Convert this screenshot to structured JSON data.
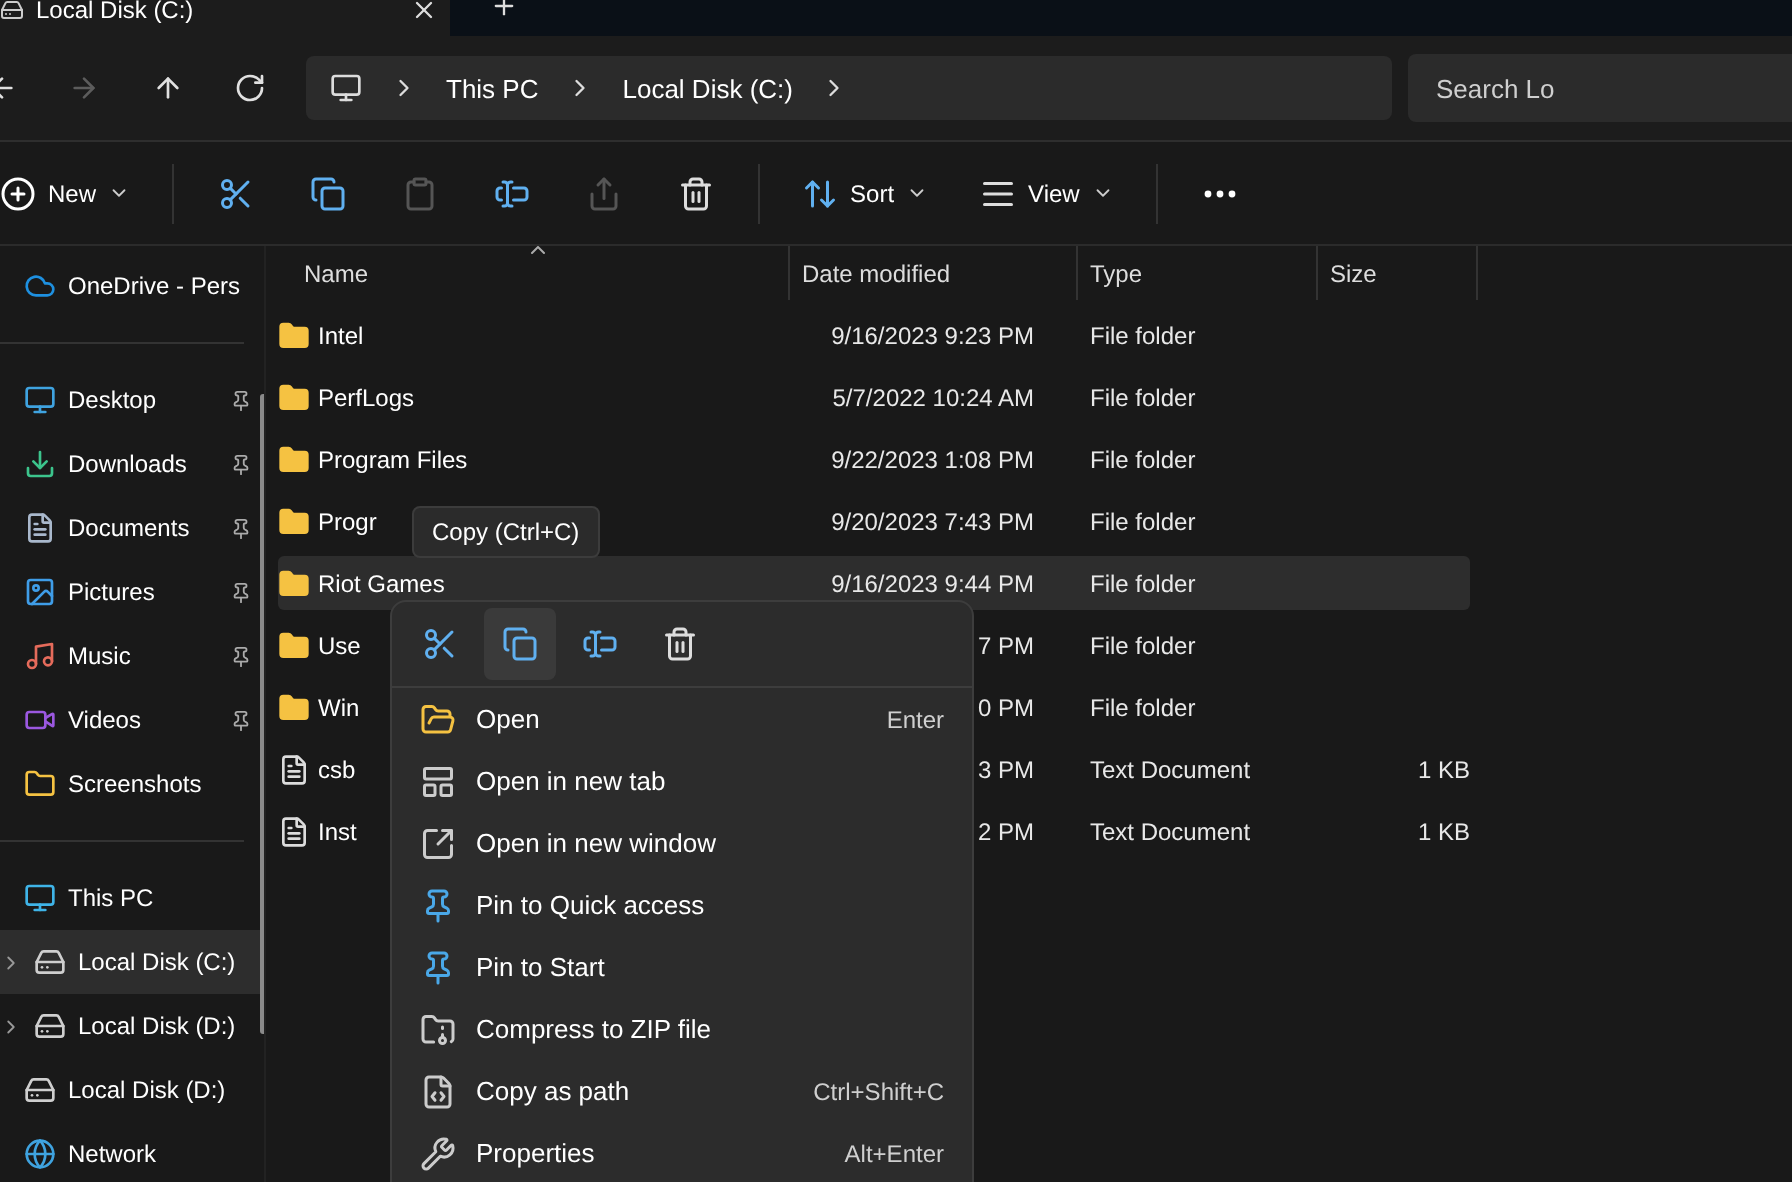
{
  "tabs": [
    {
      "label": "Local Disk (C:)",
      "selected": true
    }
  ],
  "address": {
    "crumbs": [
      "This PC",
      "Local Disk (C:)"
    ],
    "search_placeholder": "Search Lo"
  },
  "nav_buttons": [
    {
      "kind": "back",
      "disabled": false
    },
    {
      "kind": "forward",
      "disabled": true
    },
    {
      "kind": "up",
      "disabled": false
    },
    {
      "kind": "refresh",
      "disabled": false
    }
  ],
  "toolbar": [
    {
      "kind": "new",
      "label": "New",
      "disabled": false
    },
    {
      "kind": "cut",
      "disabled": false
    },
    {
      "kind": "copy",
      "disabled": false
    },
    {
      "kind": "paste",
      "disabled": true
    },
    {
      "kind": "rename",
      "disabled": false
    },
    {
      "kind": "share",
      "disabled": true
    },
    {
      "kind": "delete",
      "disabled": false
    },
    {
      "kind": "sort",
      "label": "Sort",
      "disabled": false
    },
    {
      "kind": "view",
      "label": "View",
      "disabled": false
    },
    {
      "kind": "more",
      "disabled": false
    }
  ],
  "sidebar": [
    {
      "kind": "onedrive",
      "label": "OneDrive - Pers",
      "pinned": false,
      "selected": false,
      "expander": false,
      "group_end": true
    },
    {
      "kind": "desktop",
      "label": "Desktop",
      "pinned": true,
      "selected": false,
      "expander": false,
      "group_end": false
    },
    {
      "kind": "downloads",
      "label": "Downloads",
      "pinned": true,
      "selected": false,
      "expander": false,
      "group_end": false
    },
    {
      "kind": "documents",
      "label": "Documents",
      "pinned": true,
      "selected": false,
      "expander": false,
      "group_end": false
    },
    {
      "kind": "pictures",
      "label": "Pictures",
      "pinned": true,
      "selected": false,
      "expander": false,
      "group_end": false
    },
    {
      "kind": "music",
      "label": "Music",
      "pinned": true,
      "selected": false,
      "expander": false,
      "group_end": false
    },
    {
      "kind": "videos",
      "label": "Videos",
      "pinned": true,
      "selected": false,
      "expander": false,
      "group_end": false
    },
    {
      "kind": "folder",
      "label": "Screenshots",
      "pinned": false,
      "selected": false,
      "expander": false,
      "group_end": true
    },
    {
      "kind": "pc",
      "label": "This PC",
      "pinned": false,
      "selected": false,
      "expander": false,
      "group_end": false
    },
    {
      "kind": "disk-c",
      "label": "Local Disk (C:)",
      "pinned": false,
      "selected": true,
      "expander": true,
      "group_end": false
    },
    {
      "kind": "disk",
      "label": "Local Disk (D:)",
      "pinned": false,
      "selected": false,
      "expander": true,
      "group_end": false
    },
    {
      "kind": "disk",
      "label": "Local Disk (D:)",
      "pinned": false,
      "selected": false,
      "expander": false,
      "group_end": false
    },
    {
      "kind": "network",
      "label": "Network",
      "pinned": false,
      "selected": false,
      "expander": false,
      "group_end": false
    }
  ],
  "table": {
    "columns": [
      "Name",
      "Date modified",
      "Type",
      "Size"
    ],
    "rows": [
      {
        "kind": "folder",
        "name": "Intel",
        "date": "9/16/2023 9:23 PM",
        "type": "File folder",
        "selected": false
      },
      {
        "kind": "folder",
        "name": "PerfLogs",
        "date": "5/7/2022 10:24 AM",
        "type": "File folder",
        "selected": false
      },
      {
        "kind": "folder",
        "name": "Program Files",
        "date": "9/22/2023 1:08 PM",
        "type": "File folder",
        "selected": false
      },
      {
        "kind": "folder",
        "name": "Progr",
        "date": "9/20/2023 7:43 PM",
        "type": "File folder",
        "selected": false
      },
      {
        "kind": "folder",
        "name": "Riot Games",
        "date": "9/16/2023 9:44 PM",
        "type": "File folder",
        "selected": true
      },
      {
        "kind": "folder",
        "name": "Use",
        "date": "7 PM",
        "type": "File folder",
        "selected": false
      },
      {
        "kind": "folder",
        "name": "Win",
        "date": "0 PM",
        "type": "File folder",
        "selected": false
      },
      {
        "kind": "text",
        "name": "csb",
        "date": "3 PM",
        "type": "Text Document",
        "size": "1 KB",
        "selected": false
      },
      {
        "kind": "text",
        "name": "Inst",
        "date": "2 PM",
        "type": "Text Document",
        "size": "1 KB",
        "selected": false
      }
    ]
  },
  "tooltip": "Copy (Ctrl+C)",
  "context_menu": {
    "quick_actions": [
      {
        "kind": "cut",
        "selected": false
      },
      {
        "kind": "copy",
        "selected": true
      },
      {
        "kind": "rename",
        "selected": false
      },
      {
        "kind": "delete",
        "selected": false
      }
    ],
    "items": [
      {
        "kind": "open",
        "label": "Open",
        "shortcut": "Enter"
      },
      {
        "kind": "new-tab",
        "label": "Open in new tab"
      },
      {
        "kind": "new-window",
        "label": "Open in new window"
      },
      {
        "kind": "pin",
        "label": "Pin to Quick access"
      },
      {
        "kind": "pin",
        "label": "Pin to Start"
      },
      {
        "kind": "zip",
        "label": "Compress to ZIP file"
      },
      {
        "kind": "path",
        "label": "Copy as path",
        "shortcut": "Ctrl+Shift+C"
      },
      {
        "kind": "properties",
        "label": "Properties",
        "shortcut": "Alt+Enter"
      }
    ]
  }
}
